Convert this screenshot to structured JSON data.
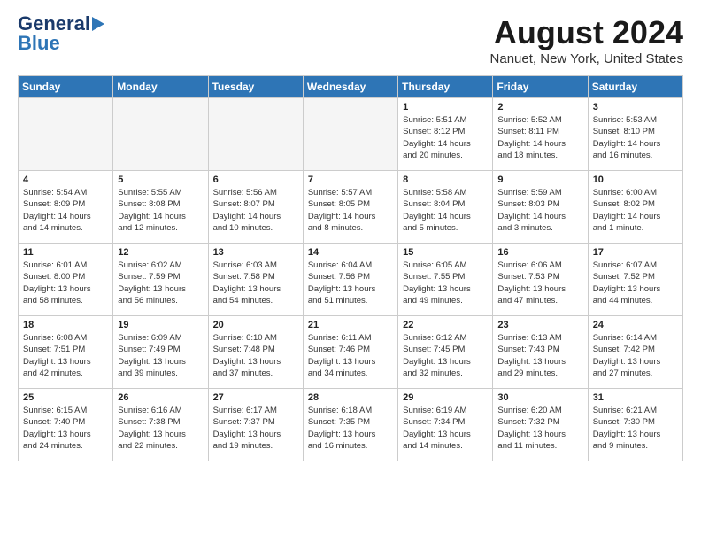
{
  "header": {
    "logo_general": "General",
    "logo_blue": "Blue",
    "month": "August 2024",
    "location": "Nanuet, New York, United States"
  },
  "days_of_week": [
    "Sunday",
    "Monday",
    "Tuesday",
    "Wednesday",
    "Thursday",
    "Friday",
    "Saturday"
  ],
  "weeks": [
    [
      {
        "day": "",
        "info": "",
        "empty": true
      },
      {
        "day": "",
        "info": "",
        "empty": true
      },
      {
        "day": "",
        "info": "",
        "empty": true
      },
      {
        "day": "",
        "info": "",
        "empty": true
      },
      {
        "day": "1",
        "info": "Sunrise: 5:51 AM\nSunset: 8:12 PM\nDaylight: 14 hours\nand 20 minutes."
      },
      {
        "day": "2",
        "info": "Sunrise: 5:52 AM\nSunset: 8:11 PM\nDaylight: 14 hours\nand 18 minutes."
      },
      {
        "day": "3",
        "info": "Sunrise: 5:53 AM\nSunset: 8:10 PM\nDaylight: 14 hours\nand 16 minutes."
      }
    ],
    [
      {
        "day": "4",
        "info": "Sunrise: 5:54 AM\nSunset: 8:09 PM\nDaylight: 14 hours\nand 14 minutes."
      },
      {
        "day": "5",
        "info": "Sunrise: 5:55 AM\nSunset: 8:08 PM\nDaylight: 14 hours\nand 12 minutes."
      },
      {
        "day": "6",
        "info": "Sunrise: 5:56 AM\nSunset: 8:07 PM\nDaylight: 14 hours\nand 10 minutes."
      },
      {
        "day": "7",
        "info": "Sunrise: 5:57 AM\nSunset: 8:05 PM\nDaylight: 14 hours\nand 8 minutes."
      },
      {
        "day": "8",
        "info": "Sunrise: 5:58 AM\nSunset: 8:04 PM\nDaylight: 14 hours\nand 5 minutes."
      },
      {
        "day": "9",
        "info": "Sunrise: 5:59 AM\nSunset: 8:03 PM\nDaylight: 14 hours\nand 3 minutes."
      },
      {
        "day": "10",
        "info": "Sunrise: 6:00 AM\nSunset: 8:02 PM\nDaylight: 14 hours\nand 1 minute."
      }
    ],
    [
      {
        "day": "11",
        "info": "Sunrise: 6:01 AM\nSunset: 8:00 PM\nDaylight: 13 hours\nand 58 minutes."
      },
      {
        "day": "12",
        "info": "Sunrise: 6:02 AM\nSunset: 7:59 PM\nDaylight: 13 hours\nand 56 minutes."
      },
      {
        "day": "13",
        "info": "Sunrise: 6:03 AM\nSunset: 7:58 PM\nDaylight: 13 hours\nand 54 minutes."
      },
      {
        "day": "14",
        "info": "Sunrise: 6:04 AM\nSunset: 7:56 PM\nDaylight: 13 hours\nand 51 minutes."
      },
      {
        "day": "15",
        "info": "Sunrise: 6:05 AM\nSunset: 7:55 PM\nDaylight: 13 hours\nand 49 minutes."
      },
      {
        "day": "16",
        "info": "Sunrise: 6:06 AM\nSunset: 7:53 PM\nDaylight: 13 hours\nand 47 minutes."
      },
      {
        "day": "17",
        "info": "Sunrise: 6:07 AM\nSunset: 7:52 PM\nDaylight: 13 hours\nand 44 minutes."
      }
    ],
    [
      {
        "day": "18",
        "info": "Sunrise: 6:08 AM\nSunset: 7:51 PM\nDaylight: 13 hours\nand 42 minutes."
      },
      {
        "day": "19",
        "info": "Sunrise: 6:09 AM\nSunset: 7:49 PM\nDaylight: 13 hours\nand 39 minutes."
      },
      {
        "day": "20",
        "info": "Sunrise: 6:10 AM\nSunset: 7:48 PM\nDaylight: 13 hours\nand 37 minutes."
      },
      {
        "day": "21",
        "info": "Sunrise: 6:11 AM\nSunset: 7:46 PM\nDaylight: 13 hours\nand 34 minutes."
      },
      {
        "day": "22",
        "info": "Sunrise: 6:12 AM\nSunset: 7:45 PM\nDaylight: 13 hours\nand 32 minutes."
      },
      {
        "day": "23",
        "info": "Sunrise: 6:13 AM\nSunset: 7:43 PM\nDaylight: 13 hours\nand 29 minutes."
      },
      {
        "day": "24",
        "info": "Sunrise: 6:14 AM\nSunset: 7:42 PM\nDaylight: 13 hours\nand 27 minutes."
      }
    ],
    [
      {
        "day": "25",
        "info": "Sunrise: 6:15 AM\nSunset: 7:40 PM\nDaylight: 13 hours\nand 24 minutes."
      },
      {
        "day": "26",
        "info": "Sunrise: 6:16 AM\nSunset: 7:38 PM\nDaylight: 13 hours\nand 22 minutes."
      },
      {
        "day": "27",
        "info": "Sunrise: 6:17 AM\nSunset: 7:37 PM\nDaylight: 13 hours\nand 19 minutes."
      },
      {
        "day": "28",
        "info": "Sunrise: 6:18 AM\nSunset: 7:35 PM\nDaylight: 13 hours\nand 16 minutes."
      },
      {
        "day": "29",
        "info": "Sunrise: 6:19 AM\nSunset: 7:34 PM\nDaylight: 13 hours\nand 14 minutes."
      },
      {
        "day": "30",
        "info": "Sunrise: 6:20 AM\nSunset: 7:32 PM\nDaylight: 13 hours\nand 11 minutes."
      },
      {
        "day": "31",
        "info": "Sunrise: 6:21 AM\nSunset: 7:30 PM\nDaylight: 13 hours\nand 9 minutes."
      }
    ]
  ]
}
